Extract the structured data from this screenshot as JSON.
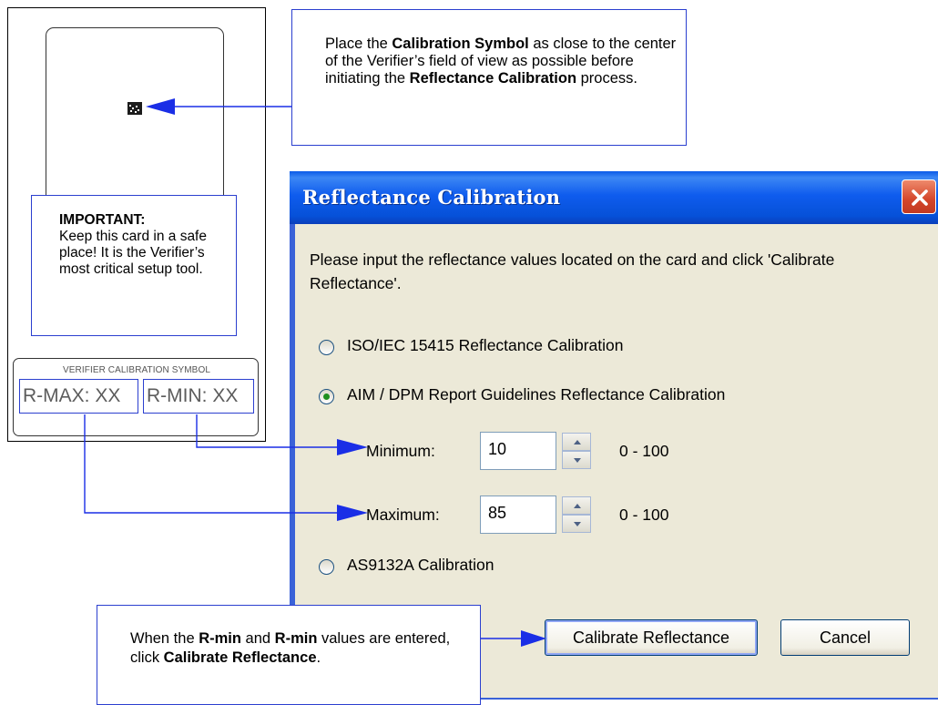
{
  "card": {
    "important_heading": "IMPORTANT:",
    "important_body": "Keep this card in a safe place! It is the Verifier’s most critical setup tool.",
    "label_title": "VERIFIER CALIBRATION SYMBOL",
    "rmax": "R-MAX: XX",
    "rmin": "R-MIN: XX"
  },
  "top_callout": {
    "p1": "Place the ",
    "b1": "Calibration Symbol",
    "p2": " as close to the center of the Verifier’s field of view as possible before initiating the ",
    "b2": "Reflectance Calibration",
    "p3": " process."
  },
  "dialog": {
    "title": "Reflectance Calibration",
    "instructions": "Please input the reflectance values located on the card and click 'Calibrate Reflectance'.",
    "options": [
      {
        "label": "ISO/IEC 15415 Reflectance Calibration",
        "selected": false
      },
      {
        "label": "AIM / DPM Report Guidelines Reflectance Calibration",
        "selected": true
      },
      {
        "label": "AS9132A Calibration",
        "selected": false
      }
    ],
    "minimum": {
      "label": "Minimum:",
      "value": "10",
      "range": "0 - 100"
    },
    "maximum": {
      "label": "Maximum:",
      "value": "85",
      "range": "0 - 100"
    },
    "calibrate_label": "Calibrate Reflectance",
    "cancel_label": "Cancel"
  },
  "bottom_callout": {
    "p1": "When the ",
    "b1": "R-min",
    "p2": " and ",
    "b2": "R-min",
    "p3": " values are entered, click ",
    "b3": "Calibrate Reflectance",
    "p4": "."
  },
  "colors": {
    "callout_border": "#2b3fcf",
    "arrow": "#1a2ee6",
    "title_bar": "#0a5ae8",
    "dialog_face": "#ece9d8",
    "radio_selected": "#1f8f1f"
  }
}
